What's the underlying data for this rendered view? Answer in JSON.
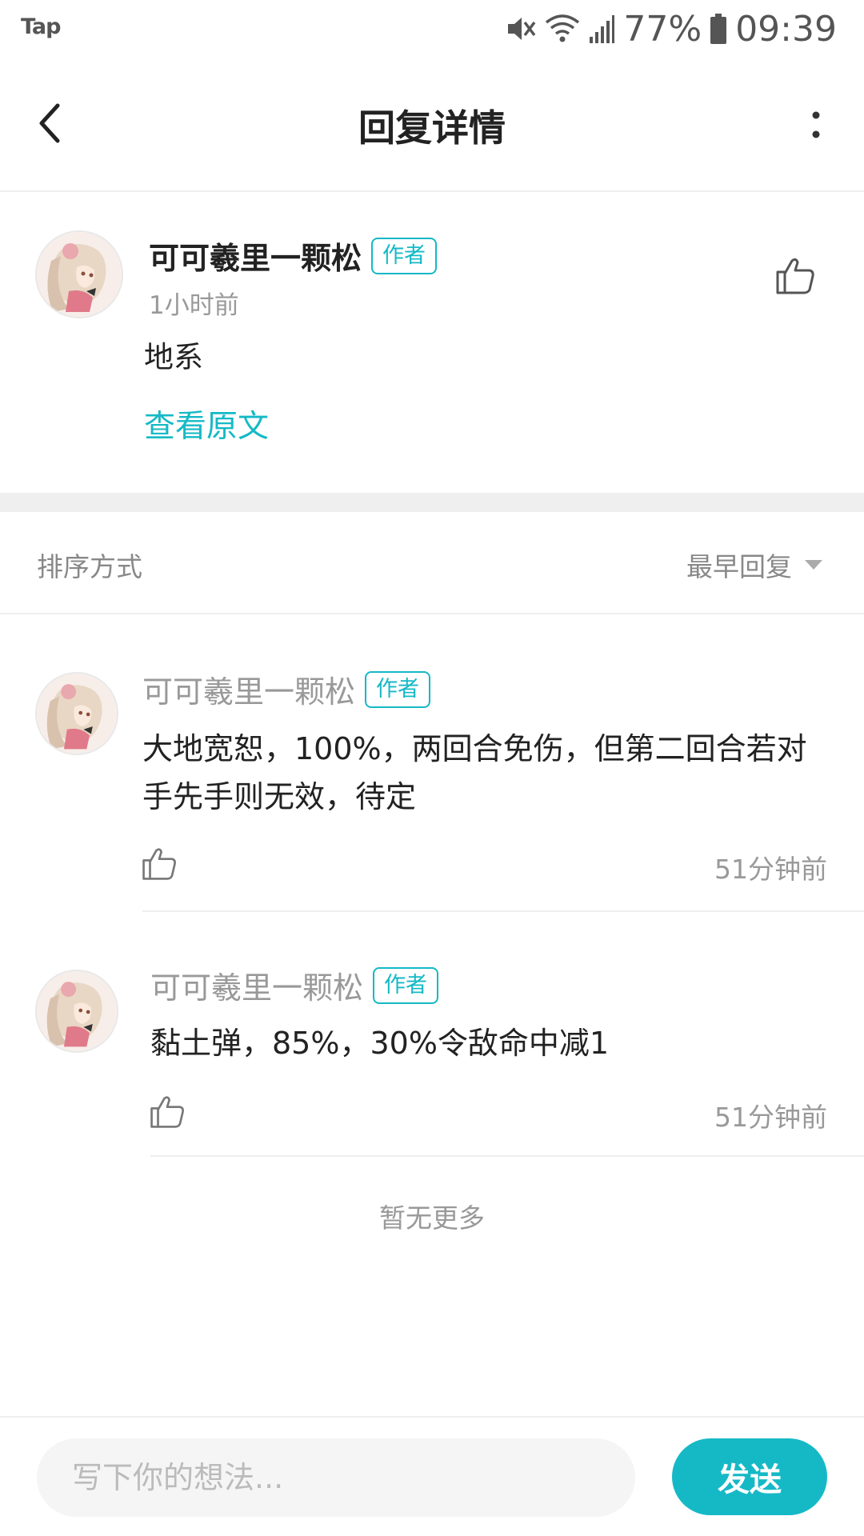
{
  "status_bar": {
    "app_label": "Tap",
    "battery": "77%",
    "time": "09:39"
  },
  "header": {
    "title": "回复详情"
  },
  "main_comment": {
    "author": "可可羲里一颗松",
    "badge": "作者",
    "time": "1小时前",
    "text": "地系",
    "view_original": "查看原文"
  },
  "sort": {
    "label": "排序方式",
    "value": "最早回复"
  },
  "replies": [
    {
      "author": "可可羲里一颗松",
      "badge": "作者",
      "text": "大地宽恕，100%，两回合免伤，但第二回合若对手先手则无效，待定",
      "time": "51分钟前"
    },
    {
      "author": "可可羲里一颗松",
      "badge": "作者",
      "text": "黏土弹，85%，30%令敌命中减1",
      "time": "51分钟前"
    }
  ],
  "no_more": "暂无更多",
  "input": {
    "placeholder": "写下你的想法..."
  },
  "send_label": "发送",
  "colors": {
    "accent": "#15b9c6",
    "text_primary": "#222222",
    "text_secondary": "#999999",
    "divider": "#eeeeee"
  }
}
